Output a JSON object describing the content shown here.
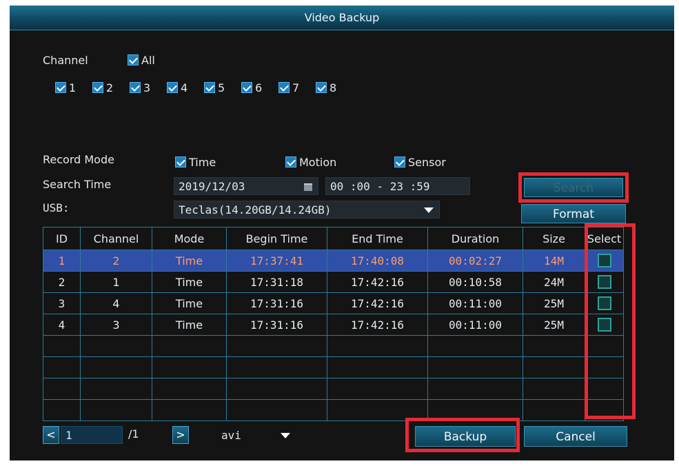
{
  "window": {
    "title": "Video Backup"
  },
  "channel": {
    "label": "Channel",
    "all_label": "All",
    "items": [
      "1",
      "2",
      "3",
      "4",
      "5",
      "6",
      "7",
      "8"
    ]
  },
  "record_mode": {
    "label": "Record Mode",
    "options": [
      "Time",
      "Motion",
      "Sensor"
    ]
  },
  "search_time": {
    "label": "Search Time",
    "date": "2019/12/03",
    "time_range": "00 :00 - 23 :59"
  },
  "usb": {
    "label": "USB:",
    "device": "Teclas(14.20GB/14.24GB)"
  },
  "buttons": {
    "search": "Search",
    "format": "Format",
    "backup": "Backup",
    "cancel": "Cancel"
  },
  "table": {
    "headers": [
      "ID",
      "Channel",
      "Mode",
      "Begin Time",
      "End Time",
      "Duration",
      "Size",
      "Select"
    ],
    "rows": [
      [
        "1",
        "2",
        "Time",
        "17:37:41",
        "17:40:08",
        "00:02:27",
        "14M"
      ],
      [
        "2",
        "1",
        "Time",
        "17:31:18",
        "17:42:16",
        "00:10:58",
        "24M"
      ],
      [
        "3",
        "4",
        "Time",
        "17:31:16",
        "17:42:16",
        "00:11:00",
        "25M"
      ],
      [
        "4",
        "3",
        "Time",
        "17:31:16",
        "17:42:16",
        "00:11:00",
        "25M"
      ]
    ],
    "selected_row": 0,
    "empty_rows": 4
  },
  "pager": {
    "current_page": "1",
    "total_pages": "/1",
    "format": "avi"
  },
  "colors": {
    "highlight": "#e62a35",
    "selected_row": "#2f4fa8",
    "accent": "#1f7fbf"
  }
}
